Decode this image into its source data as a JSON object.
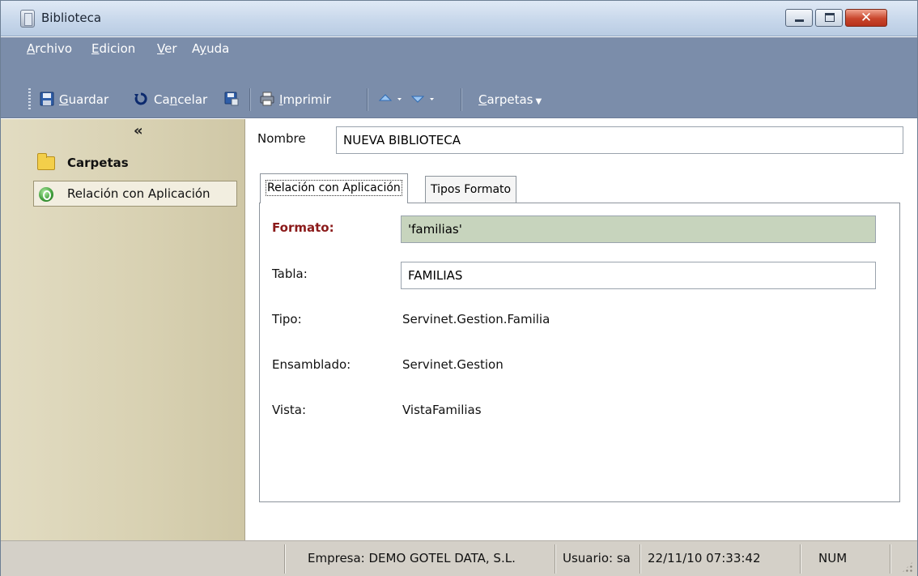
{
  "window": {
    "title": "Biblioteca"
  },
  "menu": {
    "items": [
      {
        "first": "A",
        "rest": "rchivo"
      },
      {
        "first": "E",
        "rest": "dicion"
      },
      {
        "first": "V",
        "rest": "er"
      },
      {
        "pre": "A",
        "first": "y",
        "rest": "uda"
      }
    ]
  },
  "toolbar": {
    "guardar": {
      "first": "G",
      "rest": "uardar"
    },
    "cancelar": {
      "pre": "Ca",
      "first": "n",
      "rest": "celar"
    },
    "imprimir": {
      "first": "I",
      "rest": "mprimir"
    },
    "carpetas": {
      "first": "C",
      "rest": "arpetas"
    }
  },
  "nav": {
    "collapse": "«",
    "header": "Carpetas",
    "items": [
      {
        "label": "Relación con Aplicación"
      }
    ]
  },
  "form": {
    "nombre_label": "Nombre",
    "nombre_value": "NUEVA BIBLIOTECA",
    "tabs": [
      {
        "label": "Relación con Aplicación"
      },
      {
        "label": "Tipos Formato"
      }
    ],
    "formato_label": "Formato:",
    "formato_value": "'familias'",
    "tabla_label": "Tabla:",
    "tabla_value": "FAMILIAS",
    "tipo_label": "Tipo:",
    "tipo_value": "Servinet.Gestion.Familia",
    "ensamblado_label": "Ensamblado:",
    "ensamblado_value": "Servinet.Gestion",
    "vista_label": "Vista:",
    "vista_value": "VistaFamilias"
  },
  "status": {
    "empresa": "Empresa: DEMO GOTEL DATA, S.L.",
    "usuario": "Usuario: sa",
    "datetime": "22/11/10 07:33:42",
    "num": "NUM"
  },
  "colors": {
    "formato_label": "#8b1a1a",
    "formato_field_bg": "#c7d4bd",
    "menubar": "#7b8daa",
    "left_panel": "#d8d1b2"
  }
}
